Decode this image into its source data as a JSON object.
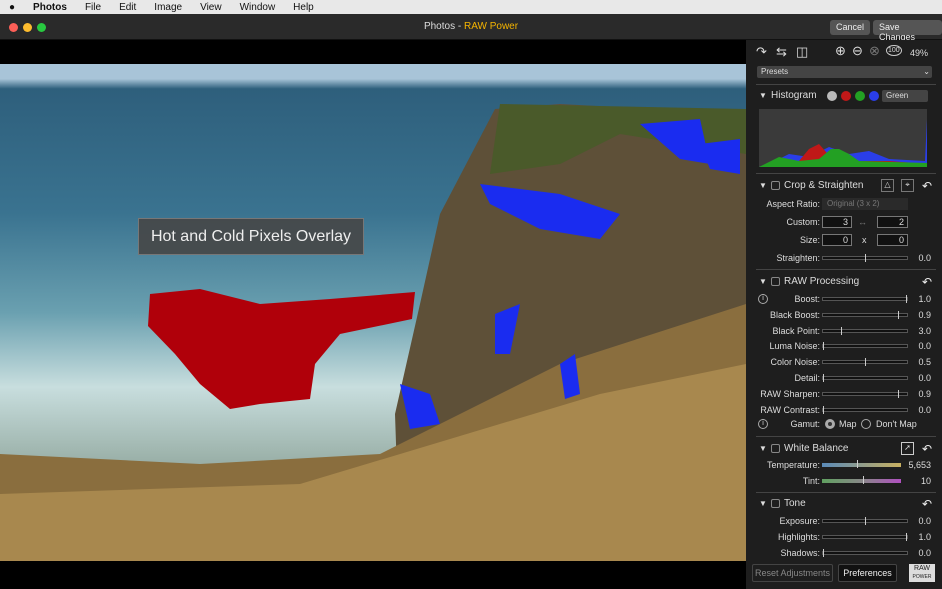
{
  "menubar": {
    "apple": "",
    "items": [
      "Photos",
      "File",
      "Edit",
      "Image",
      "View",
      "Window",
      "Help"
    ]
  },
  "window": {
    "title_app": "Photos",
    "title_sep": " - ",
    "title_plugin": "RAW Power",
    "cancel": "Cancel",
    "save": "Save Changes"
  },
  "photo": {
    "overlay_label": "Hot and Cold Pixels Overlay"
  },
  "panel": {
    "zoom": "49%",
    "zoom_actual": "100",
    "presets": "Presets",
    "histogram": {
      "title": "Histogram",
      "channel": "Green",
      "colors": {
        "all": "#bbbbbb",
        "red": "#c01818",
        "green": "#23a023",
        "blue": "#2a3ee8"
      }
    },
    "crop": {
      "title": "Crop & Straighten",
      "aspect_label": "Aspect Ratio:",
      "aspect_value": "Original (3 x 2)",
      "custom_label": "Custom:",
      "custom_w": "3",
      "custom_h": "2",
      "size_label": "Size:",
      "size_w": "0",
      "size_x": "x",
      "size_h": "0",
      "straighten_label": "Straighten:",
      "straighten_value": "0.0",
      "straighten_level": 0.5
    },
    "raw": {
      "title": "RAW Processing",
      "sliders": [
        {
          "label": "Boost:",
          "value": "1.0",
          "level": 1.0
        },
        {
          "label": "Black Boost:",
          "value": "0.9",
          "level": 0.9
        },
        {
          "label": "Black Point:",
          "value": "3.0",
          "level": 0.22
        },
        {
          "label": "Luma Noise:",
          "value": "0.0",
          "level": 0
        },
        {
          "label": "Color Noise:",
          "value": "0.5",
          "level": 0.5
        },
        {
          "label": "Detail:",
          "value": "0.0",
          "level": 0
        },
        {
          "label": "RAW Sharpen:",
          "value": "0.9",
          "level": 0.9
        },
        {
          "label": "RAW Contrast:",
          "value": "0.0",
          "level": 0
        }
      ],
      "gamut_label": "Gamut:",
      "gamut_map": "Map",
      "gamut_dont": "Don't Map",
      "gamut_selected": "Map"
    },
    "wb": {
      "title": "White Balance",
      "temp_label": "Temperature:",
      "temp_value": "5,653",
      "temp_level": 0.46,
      "tint_label": "Tint:",
      "tint_value": "10",
      "tint_level": 0.54
    },
    "tone": {
      "title": "Tone",
      "sliders": [
        {
          "label": "Exposure:",
          "value": "0.0",
          "level": 0.5
        },
        {
          "label": "Highlights:",
          "value": "1.0",
          "level": 1.0
        },
        {
          "label": "Shadows:",
          "value": "0.0",
          "level": 0
        }
      ]
    },
    "footer": {
      "reset": "Reset Adjustments",
      "prefs": "Preferences",
      "logo": "RAW POWER"
    }
  }
}
